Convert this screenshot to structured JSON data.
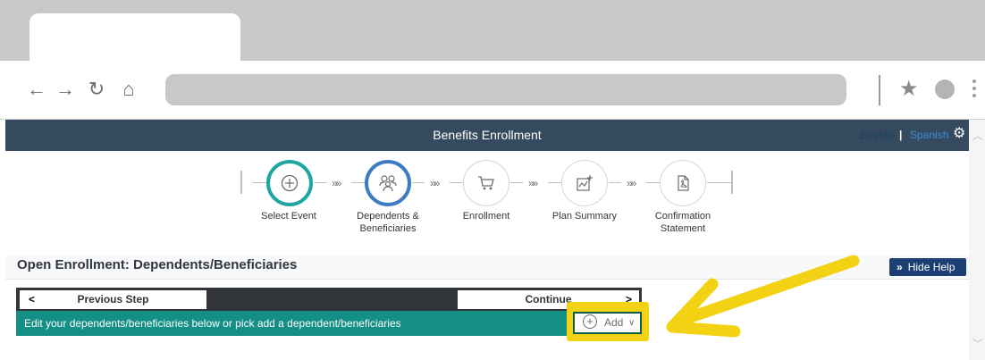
{
  "app": {
    "title": "Benefits Enrollment",
    "languages": [
      "English",
      "Spanish"
    ],
    "language_separator": "|"
  },
  "stepper": {
    "steps": [
      {
        "label": "Select Event",
        "icon": "add-circle-icon",
        "state": "active-teal"
      },
      {
        "label": "Dependents & Beneficiaries",
        "icon": "people-icon",
        "state": "active-blue"
      },
      {
        "label": "Enrollment",
        "icon": "cart-icon",
        "state": "default"
      },
      {
        "label": "Plan Summary",
        "icon": "chart-add-icon",
        "state": "default"
      },
      {
        "label": "Confirmation Statement",
        "icon": "document-pdf-icon",
        "state": "default"
      }
    ]
  },
  "section": {
    "title": "Open Enrollment: Dependents/Beneficiaries",
    "help_label": "Hide Help"
  },
  "nav": {
    "prev_label": "Previous Step",
    "continue_label": "Continue"
  },
  "info": {
    "text": "Edit your dependents/beneficiaries below or pick add a dependent/beneficiaries",
    "add_label": "Add"
  },
  "colors": {
    "header": "#354a5f",
    "teal_bar": "#138f85",
    "highlight": "#f2d213",
    "help_button": "#1b3f73",
    "step_teal": "#1fa6a0",
    "step_blue": "#3d7cc2"
  }
}
